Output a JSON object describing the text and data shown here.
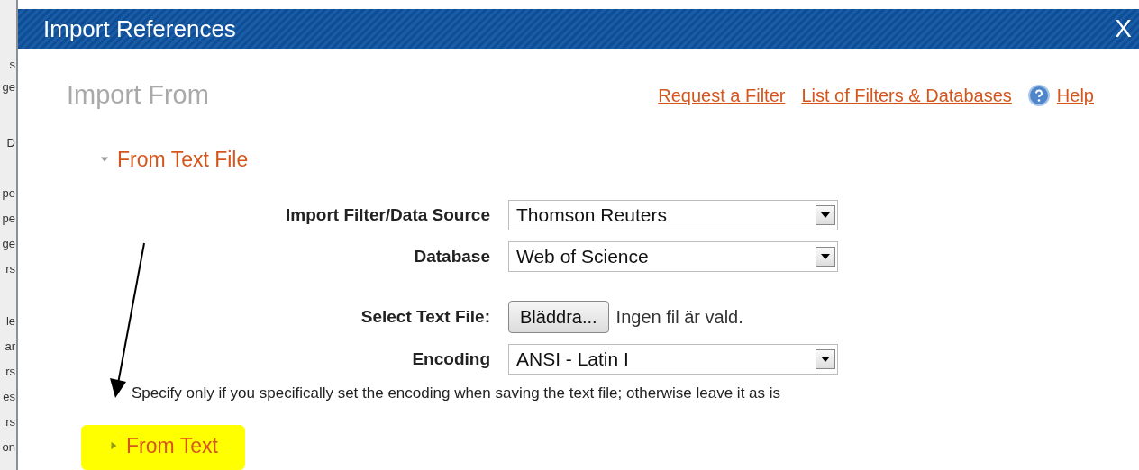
{
  "background_fragments": [
    "s",
    "ge",
    "D",
    "pe",
    "pe",
    "ge",
    "rs",
    "le",
    "ar",
    "rs",
    "es",
    "rs",
    "on"
  ],
  "window": {
    "title": "Import References",
    "close": "X"
  },
  "heading": "Import From",
  "links": [
    {
      "kind": "link",
      "label": "Request a Filter"
    },
    {
      "kind": "link",
      "label": "List of Filters & Databases"
    },
    {
      "kind": "help",
      "label": "Help"
    }
  ],
  "sections": [
    {
      "title": "From Text File",
      "expanded": true,
      "highlighted": false,
      "fields": [
        {
          "kind": "select",
          "label": "Import Filter/Data Source",
          "value": "Thomson Reuters"
        },
        {
          "kind": "select",
          "label": "Database",
          "value": "Web of Science"
        },
        {
          "kind": "file",
          "label": "Select Text File:",
          "button": "Bläddra...",
          "status": "Ingen fil är vald."
        },
        {
          "kind": "select",
          "label": "Encoding",
          "value": "ANSI - Latin I"
        }
      ],
      "note": "Specify only if you specifically set the encoding when saving the text file; otherwise leave it as is"
    },
    {
      "title": "From Text",
      "expanded": false,
      "highlighted": true
    }
  ]
}
